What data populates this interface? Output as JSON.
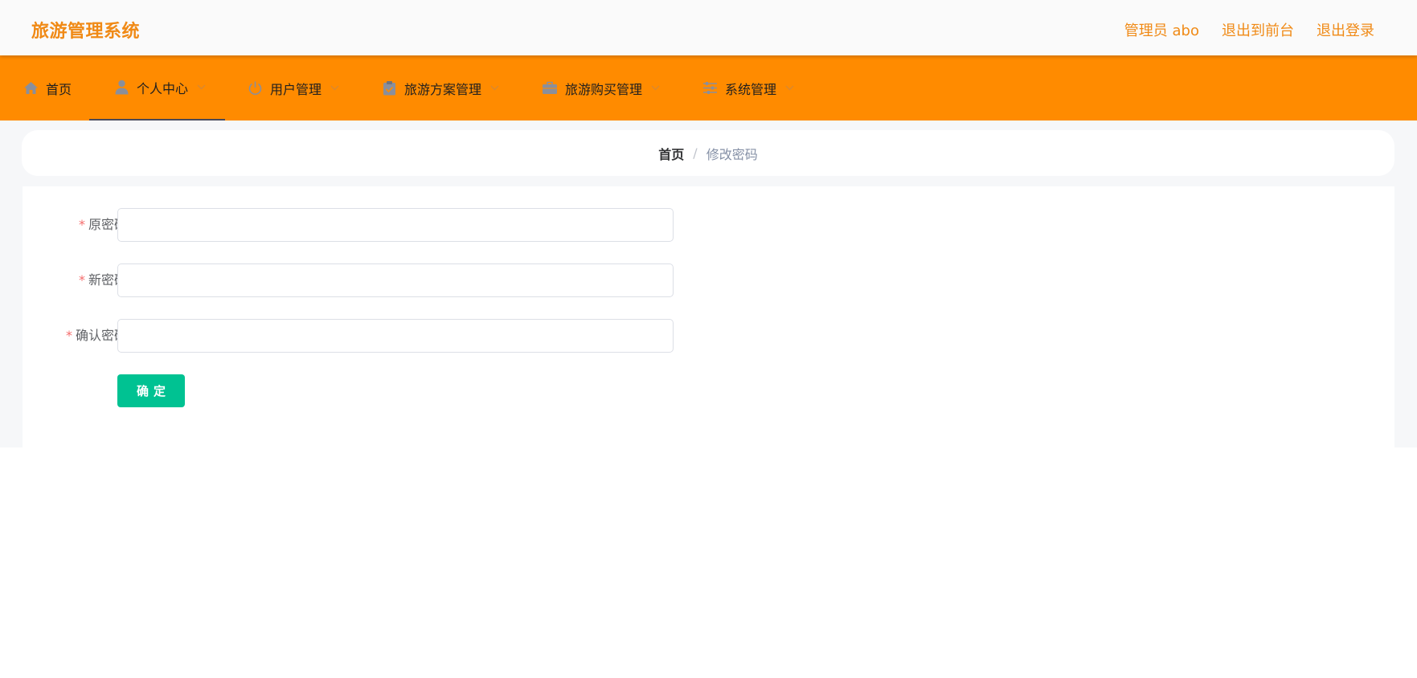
{
  "header": {
    "app_title": "旅游管理系统",
    "links": {
      "admin_user": "管理员 abo",
      "exit_to_front": "退出到前台",
      "logout": "退出登录"
    }
  },
  "nav": {
    "items": [
      {
        "label": "首页",
        "icon": "home-icon",
        "has_dropdown": false,
        "active": false
      },
      {
        "label": "个人中心",
        "icon": "user-icon",
        "has_dropdown": true,
        "active": true
      },
      {
        "label": "用户管理",
        "icon": "power-icon",
        "has_dropdown": true,
        "active": false
      },
      {
        "label": "旅游方案管理",
        "icon": "clipboard-icon",
        "has_dropdown": true,
        "active": false
      },
      {
        "label": "旅游购买管理",
        "icon": "briefcase-icon",
        "has_dropdown": true,
        "active": false
      },
      {
        "label": "系统管理",
        "icon": "sliders-icon",
        "has_dropdown": true,
        "active": false
      }
    ]
  },
  "breadcrumb": {
    "home": "首页",
    "separator": "/",
    "current": "修改密码"
  },
  "form": {
    "required_mark": "*",
    "fields": [
      {
        "label": "原密码",
        "value": "",
        "placeholder": ""
      },
      {
        "label": "新密码",
        "value": "",
        "placeholder": ""
      },
      {
        "label": "确认密码",
        "value": "",
        "placeholder": ""
      }
    ],
    "submit_label": "确定"
  },
  "colors": {
    "brand_orange": "#ff8b00",
    "title_orange": "#f08a16",
    "confirm_green": "#00c292",
    "required_red": "#f56c6c"
  }
}
